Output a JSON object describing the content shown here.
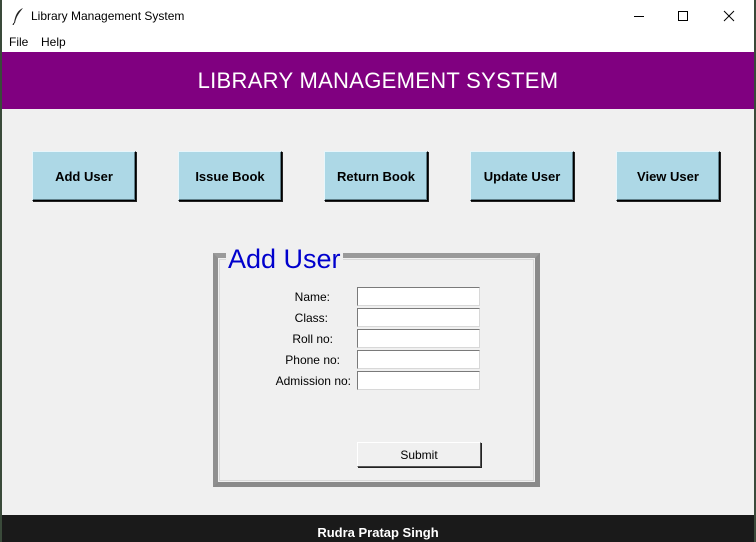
{
  "window": {
    "title": "Library Management System"
  },
  "menu": {
    "items": [
      "File",
      "Help"
    ]
  },
  "header": {
    "title": "LIBRARY MANAGEMENT SYSTEM",
    "bg_color": "#800080"
  },
  "nav": {
    "button_color": "#add8e6",
    "buttons": [
      "Add User",
      "Issue Book",
      "Return Book",
      "Update User",
      "View User"
    ]
  },
  "form": {
    "title": "Add User",
    "title_color": "#0000cd",
    "fields": [
      {
        "label": "Name:",
        "value": ""
      },
      {
        "label": "Class:",
        "value": ""
      },
      {
        "label": "Roll no:",
        "value": ""
      },
      {
        "label": "Phone no:",
        "value": ""
      },
      {
        "label": "Admission no:",
        "value": ""
      }
    ],
    "submit_label": "Submit"
  },
  "footer": {
    "text": "Rudra Pratap Singh"
  }
}
